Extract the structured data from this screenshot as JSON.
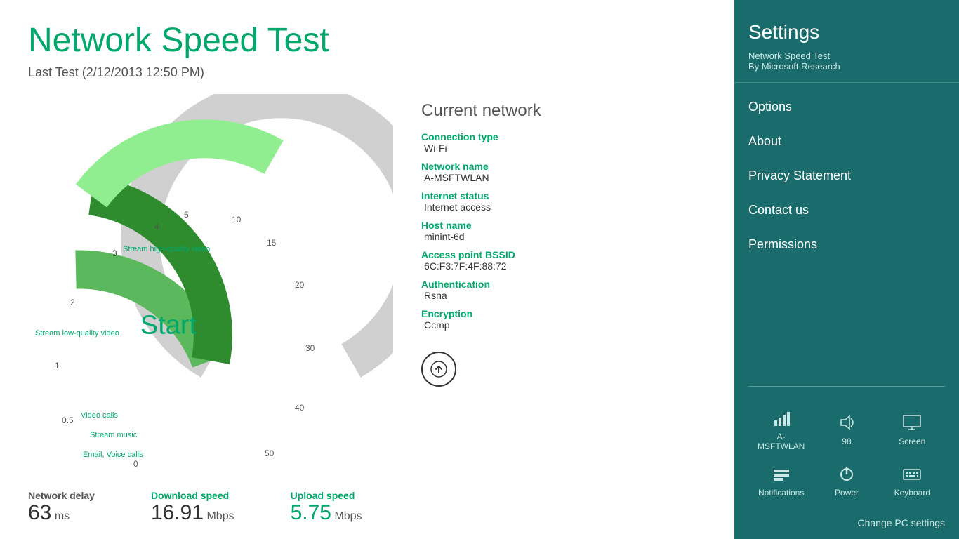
{
  "app": {
    "title": "Network Speed Test",
    "last_test": "Last Test (2/12/2013 12:50 PM)"
  },
  "gauge": {
    "start_label": "Start",
    "numbers": [
      "0",
      "0.5",
      "1",
      "2",
      "3",
      "4",
      "5",
      "10",
      "15",
      "20",
      "30",
      "40",
      "50"
    ],
    "annotations": [
      {
        "label": "Stream high-quality video",
        "value": "3"
      },
      {
        "label": "Stream low-quality video",
        "value": "2"
      },
      {
        "label": "Video calls",
        "value": "0.5"
      },
      {
        "label": "Stream music",
        "value": ""
      },
      {
        "label": "Email, Voice calls",
        "value": ""
      }
    ]
  },
  "network": {
    "title": "Current network",
    "fields": [
      {
        "label": "Connection type",
        "value": "Wi-Fi"
      },
      {
        "label": "Network name",
        "value": "A-MSFTWLAN"
      },
      {
        "label": "Internet status",
        "value": "Internet access"
      },
      {
        "label": "Host name",
        "value": "minint-6d"
      },
      {
        "label": "Access point BSSID",
        "value": "6C:F3:7F:4F:88:72"
      },
      {
        "label": "Authentication",
        "value": "Rsna"
      },
      {
        "label": "Encryption",
        "value": "Ccmp"
      }
    ]
  },
  "stats": {
    "network_delay_label": "Network delay",
    "network_delay_value": "63",
    "network_delay_unit": "ms",
    "download_label": "Download speed",
    "download_value": "16.91",
    "download_unit": "Mbps",
    "upload_label": "Upload speed",
    "upload_value": "5.75",
    "upload_unit": "Mbps"
  },
  "sidebar": {
    "title": "Settings",
    "app_name": "Network Speed Test",
    "app_sub": "By Microsoft Research",
    "menu_items": [
      "Options",
      "About",
      "Privacy Statement",
      "Contact us",
      "Permissions"
    ]
  },
  "tray": {
    "row1": [
      {
        "label": "A-MSFTWLAN",
        "icon": "wifi"
      },
      {
        "label": "98",
        "icon": "volume"
      },
      {
        "label": "Screen",
        "icon": "screen"
      }
    ],
    "row2": [
      {
        "label": "Notifications",
        "icon": "notifications"
      },
      {
        "label": "Power",
        "icon": "power"
      },
      {
        "label": "Keyboard",
        "icon": "keyboard"
      }
    ],
    "change_pc_settings": "Change PC settings"
  }
}
